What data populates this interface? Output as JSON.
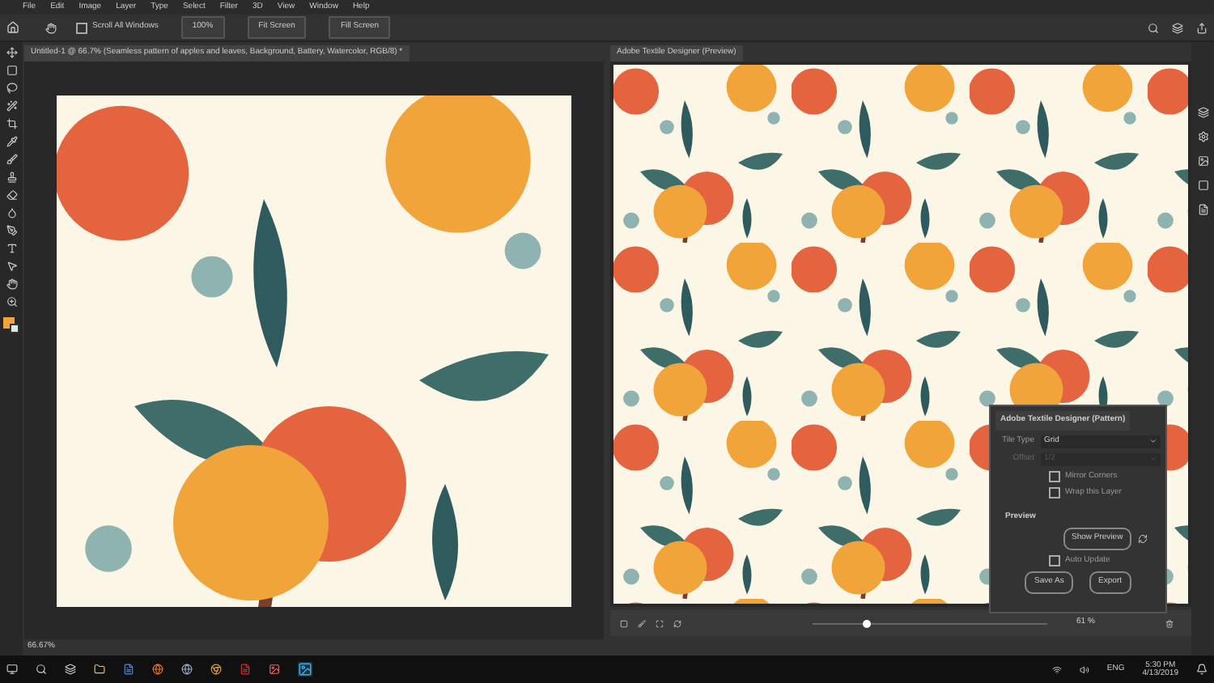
{
  "menu": [
    "File",
    "Edit",
    "Image",
    "Layer",
    "Type",
    "Select",
    "Filter",
    "3D",
    "View",
    "Window",
    "Help"
  ],
  "options_bar": {
    "scroll_all": {
      "label": "Scroll All Windows",
      "checked": false
    },
    "buttons": [
      "100%",
      "Fit Screen",
      "Fill Screen"
    ]
  },
  "document": {
    "tab_title": "Untitled-1 @ 66.7% (Seamless pattern of apples and leaves, Background, Battery, Watercolor, RGB/8) *",
    "status_zoom": "66.67%"
  },
  "preview": {
    "tab_title": "Adobe Textile Designer (Preview)",
    "zoom_label": "61 %",
    "zoom": {
      "level": 0.23
    }
  },
  "pattern_panel": {
    "title": "Adobe Textile Designer (Pattern)",
    "fields": [
      {
        "label": "Tile Type",
        "value": "Grid",
        "disabled": false
      },
      {
        "label": "Offset",
        "value": "1/2",
        "disabled": true
      }
    ],
    "checkboxes": [
      {
        "label": "Mirror Corners",
        "checked": false
      },
      {
        "label": "Wrap this Layer",
        "checked": false
      }
    ],
    "section": "Preview",
    "show_preview": "Show Preview",
    "auto_update": {
      "label": "Auto Update",
      "checked": false
    },
    "buttons": [
      "Save As",
      "Export"
    ]
  },
  "taskbar": {
    "language": "ENG",
    "time": "5:30 PM",
    "date": "4/13/2019"
  }
}
